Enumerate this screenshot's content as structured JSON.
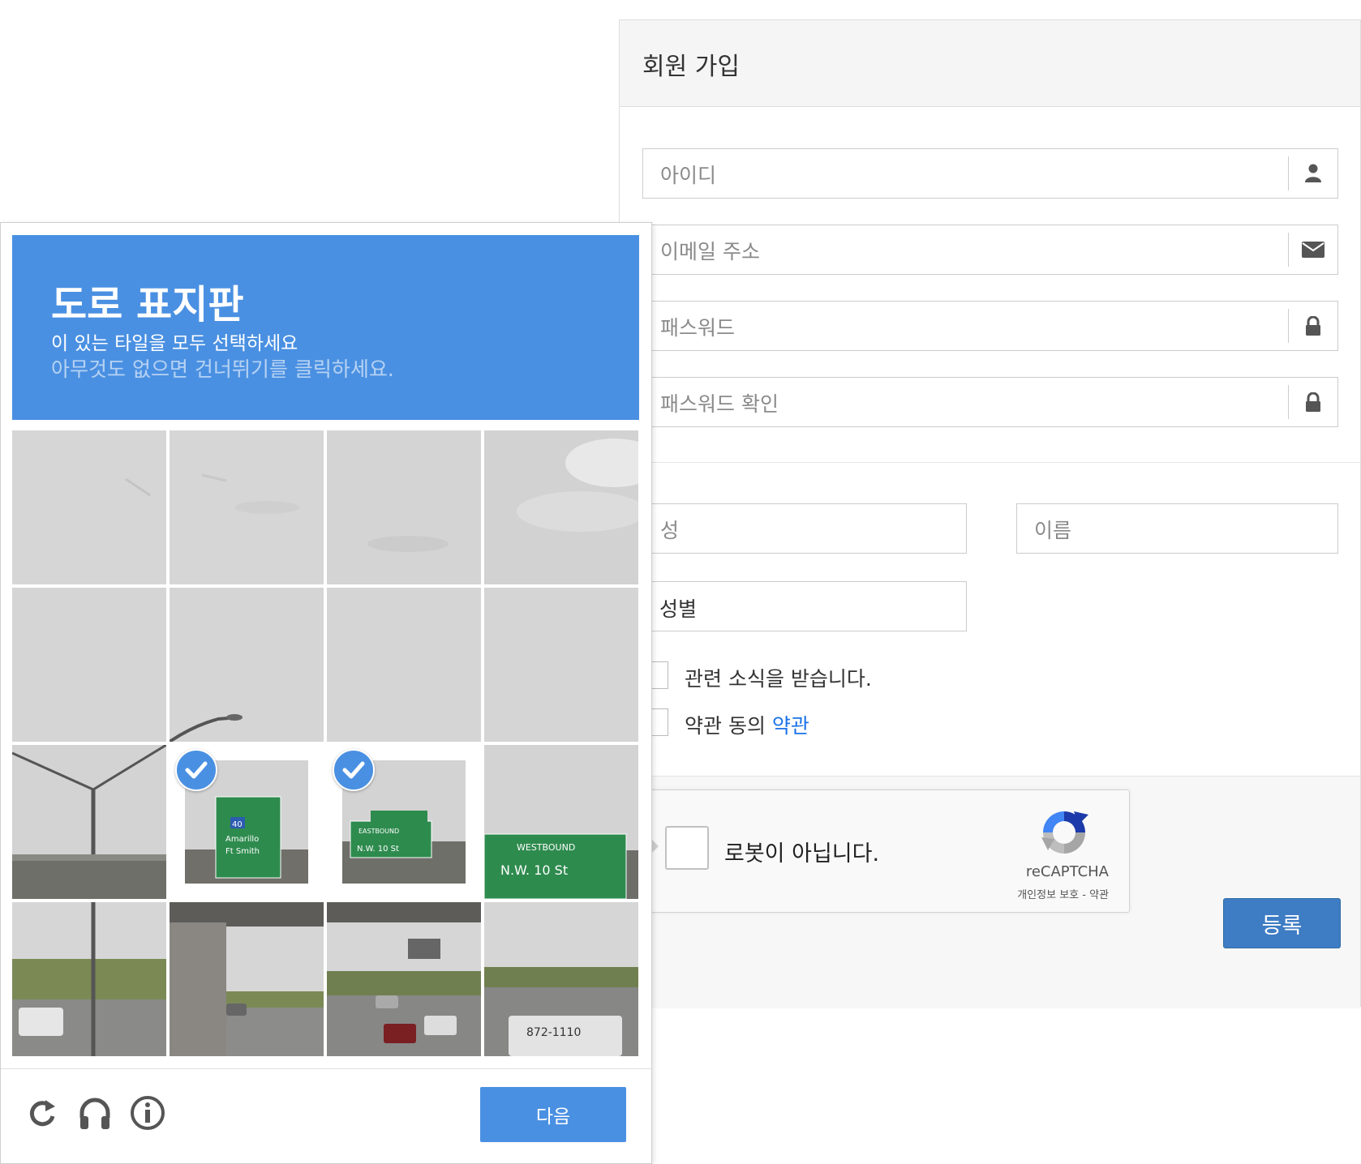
{
  "register": {
    "title": "회원 가입",
    "fields": {
      "username": {
        "placeholder": "아이디",
        "icon": "user-icon"
      },
      "email": {
        "placeholder": "이메일 주소",
        "icon": "envelope-icon"
      },
      "password": {
        "placeholder": "패스워드",
        "icon": "lock-icon"
      },
      "password_confirm": {
        "placeholder": "패스워드 확인",
        "icon": "lock-icon"
      },
      "last_name": {
        "placeholder": "성"
      },
      "first_name": {
        "placeholder": "이름"
      },
      "gender": {
        "value": "성별"
      }
    },
    "newsletter_label": "관련 소식을 받습니다.",
    "terms_label": "약관 동의",
    "terms_link": "약관",
    "recaptcha": {
      "label": "로봇이 아닙니다.",
      "brand": "reCAPTCHA",
      "legal": "개인정보 보호 - 약관"
    },
    "submit_label": "등록"
  },
  "captcha": {
    "title": "도로 표지판",
    "instruction": "이 있는 타일을 모두 선택하세요",
    "skip_hint": "아무것도 없으면 건너뛰기를 클릭하세요.",
    "selected_tiles": [
      10,
      11
    ],
    "sign_texts": {
      "tile10": [
        "40",
        "Amarillo",
        "Ft Smith"
      ],
      "tile11": [
        "EASTBOUND",
        "N.W. 10 St"
      ],
      "tile12": [
        "WESTBOUND",
        "N.W. 10 St"
      ],
      "tile16": [
        "872-1110"
      ]
    },
    "footer_icons": [
      "reload-icon",
      "headphones-icon",
      "info-icon"
    ],
    "next_label": "다음"
  },
  "colors": {
    "accent_blue": "#4a90e2",
    "submit_blue": "#3e7cc4",
    "link_blue": "#1a73e8",
    "sign_green": "#2e8b4e"
  }
}
